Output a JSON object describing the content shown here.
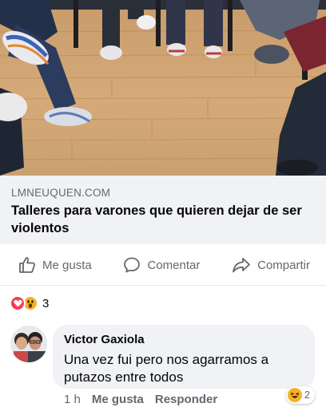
{
  "post": {
    "link_preview": {
      "image_alt": "",
      "domain": "LMNEUQUEN.COM",
      "title": "Talleres para varones que quieren dejar de ser violentos"
    },
    "actions": {
      "like_label": "Me gusta",
      "comment_label": "Comentar",
      "share_label": "Compartir"
    },
    "reactions": {
      "types": [
        "love-icon",
        "wow-icon"
      ],
      "count": "3"
    }
  },
  "comment": {
    "author": "Victor Gaxiola",
    "text": "Una vez fui pero nos agarramos a putazos entre todos",
    "time": "1 h",
    "like_label": "Me gusta",
    "reply_label": "Responder",
    "reaction_icon": "haha-icon",
    "reaction_count": "2"
  },
  "colors": {
    "secondary_text": "#65676b",
    "link_box_bg": "#f0f2f5",
    "love": "#f33e58",
    "wow": "#f7b125"
  }
}
